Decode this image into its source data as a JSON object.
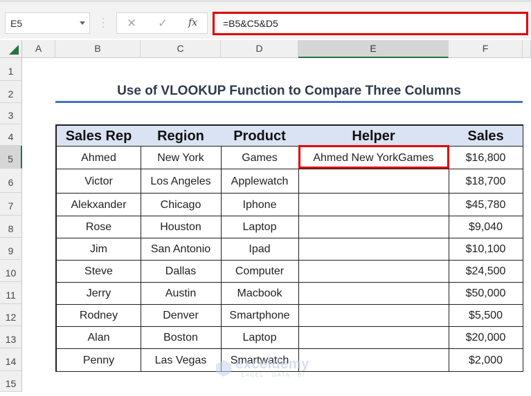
{
  "toolbar": {
    "name_box": "E5",
    "cancel_icon": "✕",
    "enter_icon": "✓",
    "fx_label": "fx",
    "formula": "=B5&C5&D5"
  },
  "columns": [
    "A",
    "B",
    "C",
    "D",
    "E",
    "F"
  ],
  "selected_column": "E",
  "rows": [
    "1",
    "2",
    "3",
    "4",
    "5",
    "6",
    "7",
    "8",
    "9",
    "10",
    "11",
    "12",
    "13",
    "14",
    "15"
  ],
  "selected_row": "5",
  "title": "Use of VLOOKUP Function to Compare Three Columns",
  "table": {
    "headers": [
      "Sales Rep",
      "Region",
      "Product",
      "Helper",
      "Sales"
    ],
    "rows": [
      [
        "Ahmed",
        "New York",
        "Games",
        "Ahmed New YorkGames",
        "$16,800"
      ],
      [
        "Victor",
        "Los Angeles",
        "Applewatch",
        "",
        "$18,700"
      ],
      [
        "Alekxander",
        "Chicago",
        "Iphone",
        "",
        "$45,780"
      ],
      [
        "Rose",
        "Houston",
        "Laptop",
        "",
        "$9,040"
      ],
      [
        "Jim",
        "San Antonio",
        "Ipad",
        "",
        "$10,100"
      ],
      [
        "Steve",
        "Dallas",
        "Computer",
        "",
        "$24,500"
      ],
      [
        "Jerry",
        "Austin",
        "Macbook",
        "",
        "$50,000"
      ],
      [
        "Rodney",
        "Denver",
        "Smartphone",
        "",
        "$5,500"
      ],
      [
        "Alan",
        "Boston",
        "Laptop",
        "",
        "$20,000"
      ],
      [
        "Penny",
        "Las Vegas",
        "Smartwatch",
        "",
        "$2,000"
      ]
    ]
  },
  "watermark": {
    "name": "exceldemy",
    "tagline": "EXCEL · DATA · BI"
  },
  "colors": {
    "accent_green": "#217346",
    "highlight_red": "#e00000",
    "header_fill": "#dae3f3",
    "title_underline": "#4472c4"
  }
}
